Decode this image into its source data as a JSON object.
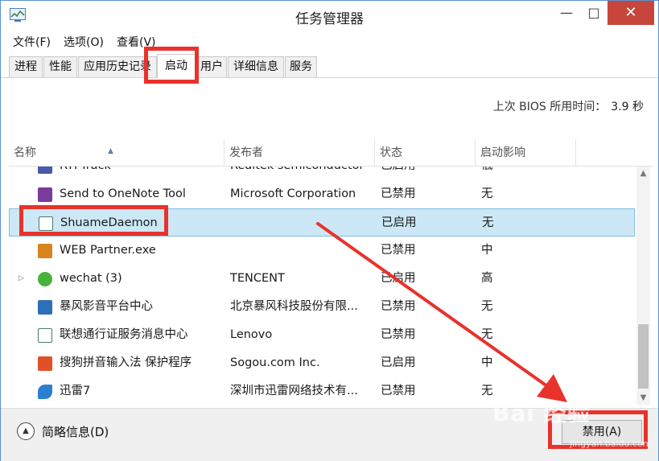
{
  "window": {
    "title": "任务管理器"
  },
  "titlebar": {
    "min": "—",
    "max": "□",
    "close": "✕"
  },
  "menu": [
    "文件(F)",
    "选项(O)",
    "查看(V)"
  ],
  "tabs": [
    "进程",
    "性能",
    "应用历史记录",
    "启动",
    "用户",
    "详细信息",
    "服务"
  ],
  "active_tab": "启动",
  "bios": {
    "label": "上次 BIOS 所用时间：",
    "value": "3.9 秒"
  },
  "columns": {
    "name": "名称",
    "publisher": "发布者",
    "status": "状态",
    "impact": "启动影响"
  },
  "rows": [
    {
      "name": "RTFTrack",
      "publisher": "Realtek semiconductor",
      "status": "已启用",
      "impact": "低",
      "icon": "realtek-icon",
      "color": "#4a5aa8"
    },
    {
      "name": "Send to OneNote Tool",
      "publisher": "Microsoft Corporation",
      "status": "已禁用",
      "impact": "无",
      "icon": "onenote-icon",
      "color": "#7a3b9c"
    },
    {
      "name": "ShuameDaemon",
      "publisher": "",
      "status": "已启用",
      "impact": "无",
      "icon": "app-window-icon",
      "color": "#4c7a6b"
    },
    {
      "name": "WEB Partner.exe",
      "publisher": "",
      "status": "已禁用",
      "impact": "中",
      "icon": "web-partner-icon",
      "color": "#d8841f"
    },
    {
      "name": "wechat (3)",
      "publisher": "TENCENT",
      "status": "已启用",
      "impact": "高",
      "icon": "wechat-icon",
      "color": "#47b33b"
    },
    {
      "name": "暴风影音平台中心",
      "publisher": "北京暴风科技股份有限...",
      "status": "已禁用",
      "impact": "无",
      "icon": "baofeng-icon",
      "color": "#2f6fb8"
    },
    {
      "name": "联想通行证服务消息中心",
      "publisher": "Lenovo",
      "status": "已禁用",
      "impact": "无",
      "icon": "lenovo-icon",
      "color": "#4c7a6b"
    },
    {
      "name": "搜狗拼音输入法 保护程序",
      "publisher": "Sogou.com Inc.",
      "status": "已启用",
      "impact": "中",
      "icon": "sogou-icon",
      "color": "#e2502a"
    },
    {
      "name": "迅雷7",
      "publisher": "深圳市迅雷网络技术有...",
      "status": "已禁用",
      "impact": "无",
      "icon": "xunlei-icon",
      "color": "#2b7fd0"
    }
  ],
  "footer": {
    "fewer_details": "简略信息(D)",
    "disable_button": "禁用(A)"
  },
  "watermark": {
    "text": "Bai 经验",
    "sub": "jingyan.baidu.com"
  },
  "colors": {
    "highlight": "#e8322b",
    "selected_row": "#cce8f6",
    "close_button": "#c7463c"
  }
}
